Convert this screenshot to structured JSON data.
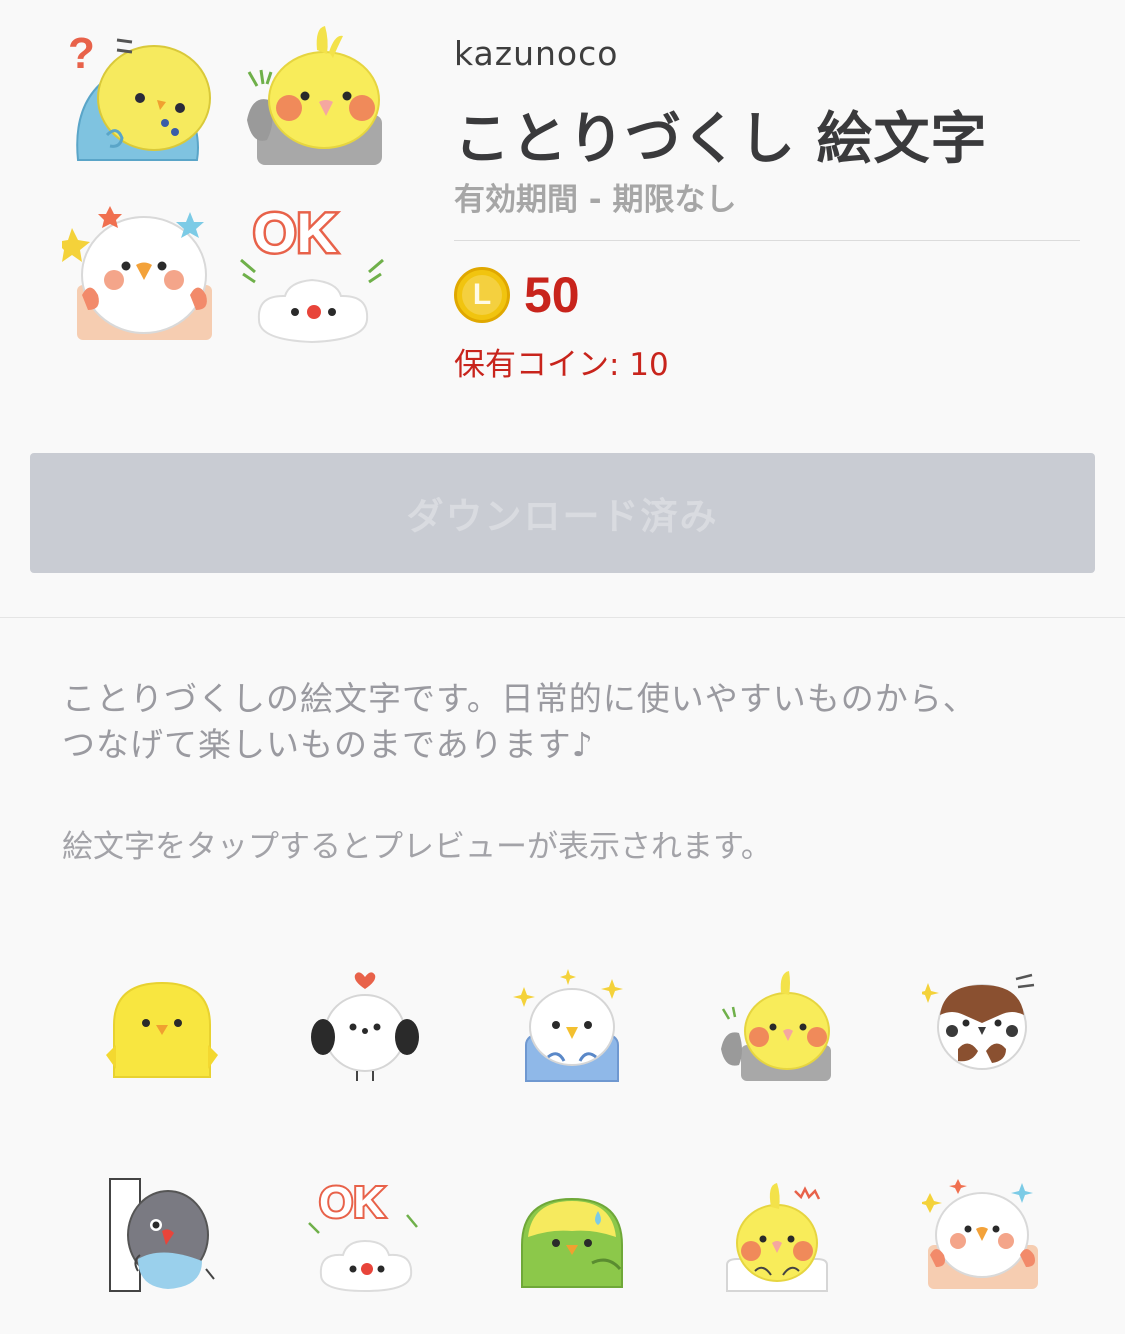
{
  "sticker": {
    "author": "kazunoco",
    "title": "ことりづくし 絵文字",
    "validity": "有効期間 - 期限なし",
    "price": "50",
    "coin_icon_letter": "L",
    "coins_owned": "保有コイン: 10",
    "download_label": "ダウンロード済み"
  },
  "description": {
    "line1": "ことりづくしの絵文字です。日常的に使いやすいものから、",
    "line2": "つなげて楽しいものまであります♪",
    "hint": "絵文字をタップするとプレビューが表示されます。"
  },
  "thumb_text": {
    "ok": "OK",
    "question": "?"
  },
  "colors": {
    "price_red": "#c8241c",
    "button_disabled": "#c9ccd3",
    "background": "#f9f9f9"
  },
  "emoji_grid": [
    {
      "name": "yellow-chick-emoji"
    },
    {
      "name": "white-bird-heart-emoji"
    },
    {
      "name": "blue-parakeet-sparkle-emoji"
    },
    {
      "name": "cockatiel-wave-emoji"
    },
    {
      "name": "sparrow-emoji"
    },
    {
      "name": "lovebird-peek-emoji"
    },
    {
      "name": "java-sparrow-ok-emoji"
    },
    {
      "name": "green-parakeet-sweat-emoji"
    },
    {
      "name": "cockatiel-surprised-emoji"
    },
    {
      "name": "white-bird-peace-emoji"
    }
  ]
}
